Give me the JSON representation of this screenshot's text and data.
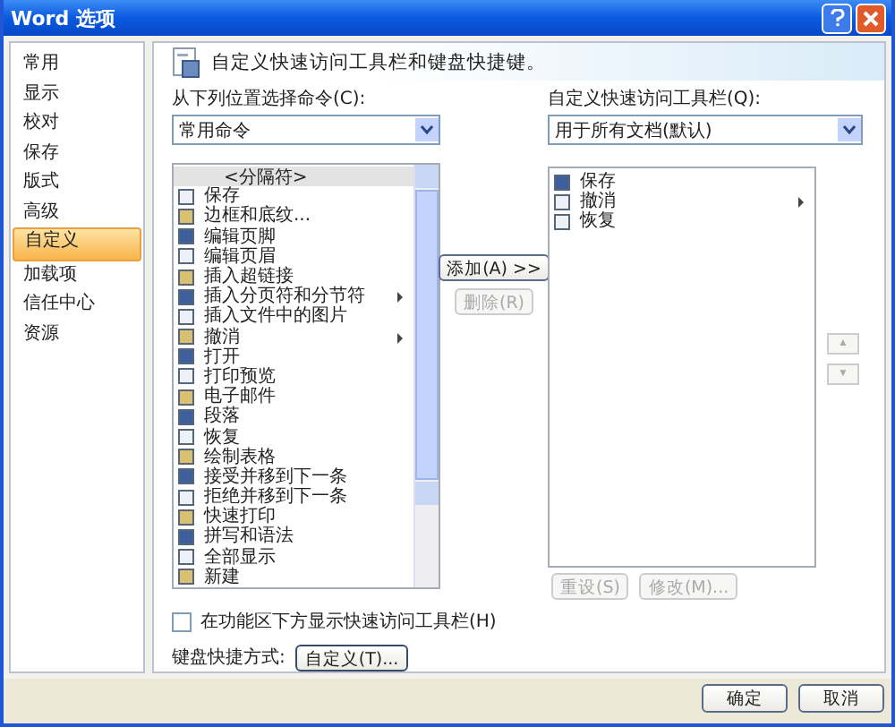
{
  "window": {
    "title": "Word 选项"
  },
  "sidebar": {
    "items": [
      {
        "label": "常用",
        "selected": false
      },
      {
        "label": "显示",
        "selected": false
      },
      {
        "label": "校对",
        "selected": false
      },
      {
        "label": "保存",
        "selected": false
      },
      {
        "label": "版式",
        "selected": false
      },
      {
        "label": "高级",
        "selected": false
      },
      {
        "label": "自定义",
        "selected": true
      },
      {
        "label": "加载项",
        "selected": false
      },
      {
        "label": "信任中心",
        "selected": false
      },
      {
        "label": "资源",
        "selected": false
      }
    ]
  },
  "header": {
    "text": "自定义快速访问工具栏和键盘快捷键。"
  },
  "source": {
    "label": "从下列位置选择命令(C):",
    "value": "常用命令"
  },
  "commands": [
    {
      "label": "<分隔符>",
      "kind": "separator",
      "selected": true,
      "submenu": false
    },
    {
      "label": "保存",
      "kind": "command",
      "selected": false,
      "submenu": false
    },
    {
      "label": "边框和底纹...",
      "kind": "command",
      "selected": false,
      "submenu": false
    },
    {
      "label": "编辑页脚",
      "kind": "command",
      "selected": false,
      "submenu": false
    },
    {
      "label": "编辑页眉",
      "kind": "command",
      "selected": false,
      "submenu": false
    },
    {
      "label": "插入超链接",
      "kind": "command",
      "selected": false,
      "submenu": false
    },
    {
      "label": "插入分页符和分节符",
      "kind": "command",
      "selected": false,
      "submenu": true
    },
    {
      "label": "插入文件中的图片",
      "kind": "command",
      "selected": false,
      "submenu": false
    },
    {
      "label": "撤消",
      "kind": "command",
      "selected": false,
      "submenu": true
    },
    {
      "label": "打开",
      "kind": "command",
      "selected": false,
      "submenu": false
    },
    {
      "label": "打印预览",
      "kind": "command",
      "selected": false,
      "submenu": false
    },
    {
      "label": "电子邮件",
      "kind": "command",
      "selected": false,
      "submenu": false
    },
    {
      "label": "段落",
      "kind": "command",
      "selected": false,
      "submenu": false
    },
    {
      "label": "恢复",
      "kind": "command",
      "selected": false,
      "submenu": false
    },
    {
      "label": "绘制表格",
      "kind": "command",
      "selected": false,
      "submenu": false
    },
    {
      "label": "接受并移到下一条",
      "kind": "command",
      "selected": false,
      "submenu": false
    },
    {
      "label": "拒绝并移到下一条",
      "kind": "command",
      "selected": false,
      "submenu": false
    },
    {
      "label": "快速打印",
      "kind": "command",
      "selected": false,
      "submenu": false
    },
    {
      "label": "拼写和语法",
      "kind": "command",
      "selected": false,
      "submenu": false
    },
    {
      "label": "全部显示",
      "kind": "command",
      "selected": false,
      "submenu": false
    },
    {
      "label": "新建",
      "kind": "command",
      "selected": false,
      "submenu": false
    }
  ],
  "add_button": {
    "label": "添加(A) >>",
    "disabled": false
  },
  "remove_button": {
    "label": "删除(R)",
    "disabled": true
  },
  "target": {
    "label": "自定义快速访问工具栏(Q):",
    "value": "用于所有文档(默认)"
  },
  "toolbar_items": [
    {
      "label": "保存",
      "submenu": false
    },
    {
      "label": "撤消",
      "submenu": true
    },
    {
      "label": "恢复",
      "submenu": false
    }
  ],
  "move_buttons": [
    {
      "label": "▲",
      "disabled": true
    },
    {
      "label": "▼",
      "disabled": true
    }
  ],
  "reset_button": {
    "label": "重设(S)",
    "disabled": true
  },
  "modify_button": {
    "label": "修改(M)...",
    "disabled": true
  },
  "show_below_ribbon": {
    "label": "在功能区下方显示快速访问工具栏(H)",
    "checked": false
  },
  "shortcuts": {
    "label": "键盘快捷方式:",
    "button": "自定义(T)..."
  },
  "footer_buttons": [
    "确定",
    "取消"
  ]
}
